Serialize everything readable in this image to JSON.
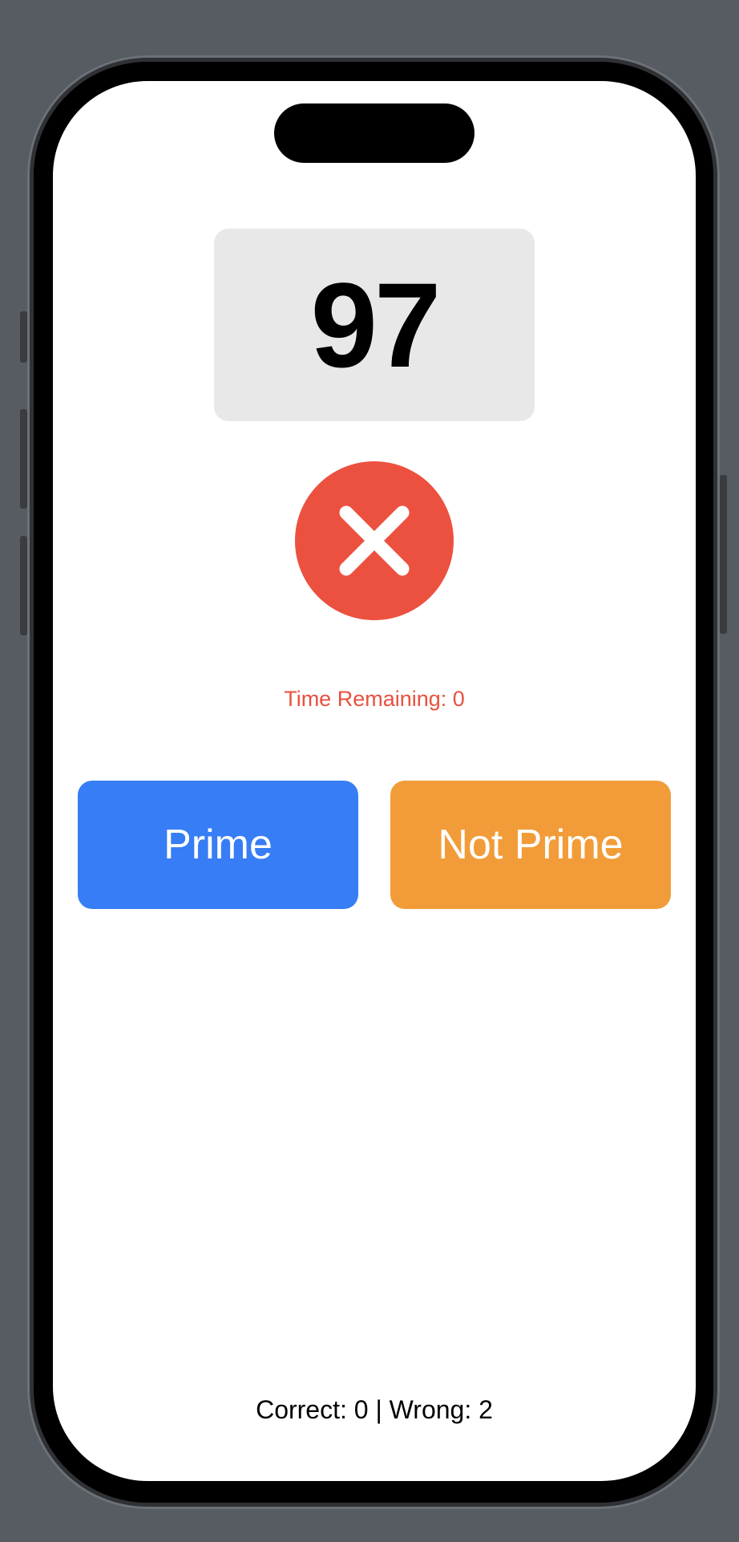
{
  "game": {
    "number": "97",
    "result_icon": "x-mark-icon",
    "time_remaining": "Time Remaining: 0",
    "score": "Correct: 0 | Wrong: 2"
  },
  "buttons": {
    "prime_label": "Prime",
    "not_prime_label": "Not Prime"
  },
  "colors": {
    "prime_button": "#377df6",
    "not_prime_button": "#f29c39",
    "wrong_indicator": "#ec5140",
    "time_text": "#e8503f",
    "number_box": "#e8e8e8"
  }
}
